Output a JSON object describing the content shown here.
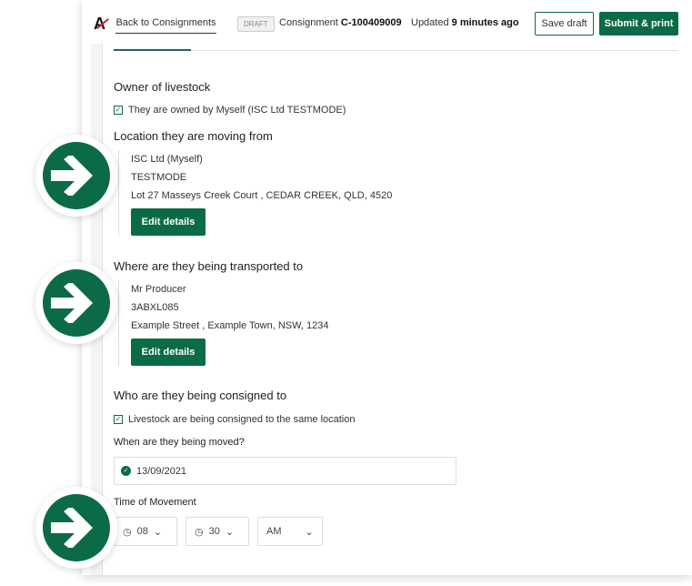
{
  "header": {
    "back_label": "Back to Consignments",
    "status_badge": "DRAFT",
    "consignment_label": "Consignment",
    "consignment_id": "C-100409009",
    "updated_label": "Updated",
    "updated_value": "9 minutes ago",
    "save_label": "Save draft",
    "submit_label": "Submit & print"
  },
  "owner": {
    "title": "Owner of livestock",
    "checkbox_label": "They are owned by Myself (ISC Ltd TESTMODE)",
    "checked": true
  },
  "from": {
    "title": "Location they are moving from",
    "name": "ISC Ltd (Myself)",
    "code": "TESTMODE",
    "address": "Lot 27 Masseys Creek Court , CEDAR CREEK, QLD, 4520",
    "edit_label": "Edit details"
  },
  "to": {
    "title": "Where are they being transported to",
    "name": "Mr Producer",
    "code": "3ABXL085",
    "address": "Example Street , Example Town, NSW, 1234",
    "edit_label": "Edit details"
  },
  "consigned": {
    "title": "Who are they being consigned to",
    "checkbox_label": "Livestock are being consigned to the same location",
    "checked": true
  },
  "move": {
    "date_label": "When are they being moved?",
    "date_value": "13/09/2021",
    "time_label": "Time of Movement",
    "hour": "08",
    "minute": "30",
    "ampm": "AM"
  },
  "colors": {
    "brand": "#0b6b45"
  }
}
